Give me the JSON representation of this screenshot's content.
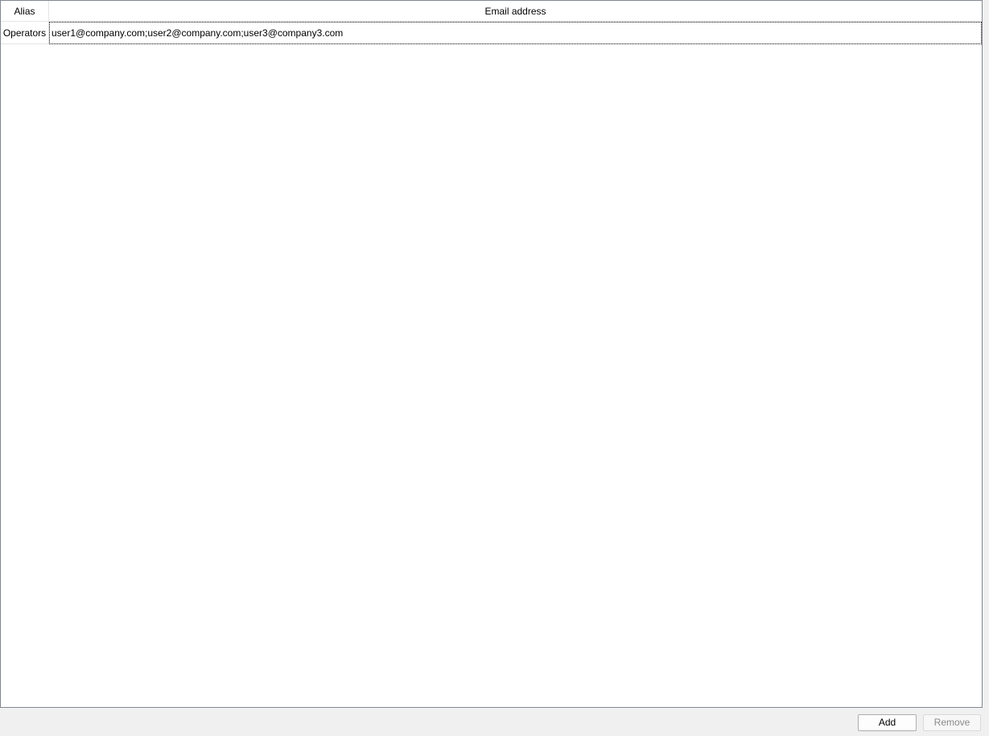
{
  "table": {
    "columns": {
      "alias": "Alias",
      "email": "Email address"
    },
    "rows": [
      {
        "alias": "Operators",
        "email": "user1@company.com;user2@company.com;user3@company3.com"
      }
    ]
  },
  "buttons": {
    "add": "Add",
    "remove": "Remove"
  }
}
